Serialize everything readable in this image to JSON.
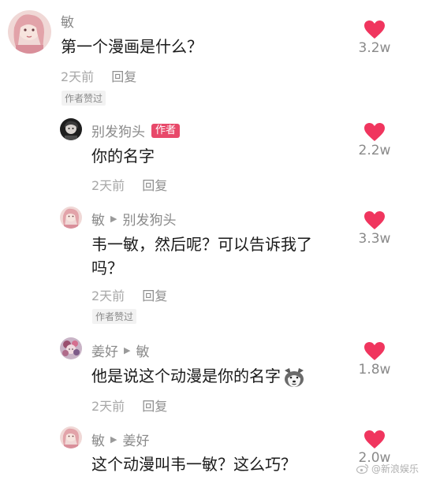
{
  "comments": [
    {
      "author": "敏",
      "text_lines": [
        "第一个漫画是什么？"
      ],
      "time": "2天前",
      "reply": "回复",
      "badge": "作者赞过",
      "likes": "3.2w",
      "avatar_color": "#e9c2c4"
    },
    {
      "author": "别发狗头",
      "author_tag": "作者",
      "text_lines": [
        "你的名字"
      ],
      "time": "2天前",
      "reply": "回复",
      "likes": "2.2w",
      "avatar_color": "#2a2a2a"
    },
    {
      "author": "敏",
      "reply_to": "别发狗头",
      "text_lines": [
        "韦一敏，然后呢？可以告诉我了",
        "吗？"
      ],
      "time": "2天前",
      "reply": "回复",
      "badge": "作者赞过",
      "likes": "3.3w",
      "avatar_color": "#e9c2c4"
    },
    {
      "author": "姜好",
      "reply_to": "敏",
      "text_lines": [
        "他是说这个动漫是你的名字"
      ],
      "emoji": "dog-face-emoji",
      "time": "2天前",
      "reply": "回复",
      "likes": "1.8w",
      "avatar_color": "#8c6b8e"
    },
    {
      "author": "敏",
      "reply_to": "姜好",
      "text_lines": [
        "这个动漫叫韦一敏？这么巧？"
      ],
      "likes": "2.0w",
      "avatar_color": "#e9c2c4"
    }
  ],
  "colors": {
    "heart": "#f0355e",
    "author_tag": "#e8496a"
  },
  "watermark": "@新浪娱乐"
}
